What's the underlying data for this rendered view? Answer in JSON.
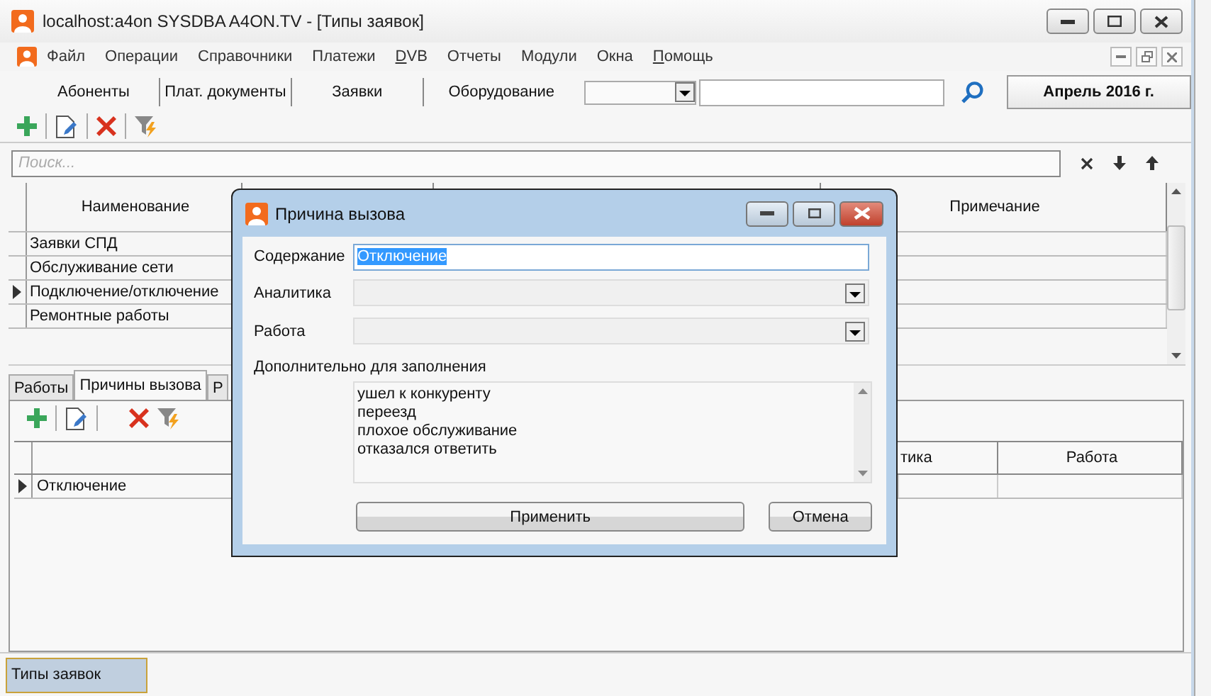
{
  "window": {
    "title": "localhost:a4on SYSDBA A4ON.TV - [Типы заявок]"
  },
  "menu": [
    {
      "label": "Файл",
      "underline_first": false
    },
    {
      "label": "Операции",
      "underline_first": false
    },
    {
      "label": "Справочники",
      "underline_first": false
    },
    {
      "label": "Платежи",
      "underline_first": false
    },
    {
      "label": "DVB",
      "underline_first": true
    },
    {
      "label": "Отчеты",
      "underline_first": false
    },
    {
      "label": "Модули",
      "underline_first": false
    },
    {
      "label": "Окна",
      "underline_first": false
    },
    {
      "label": "Помощь",
      "underline_first": true
    }
  ],
  "nav_tabs": [
    "Абоненты",
    "Плат. документы",
    "Заявки",
    "Оборудование"
  ],
  "period_button": "Апрель 2016 г.",
  "search": {
    "placeholder": "Поиск..."
  },
  "grid": {
    "columns": [
      "Наименование",
      "Примечание"
    ],
    "rows": [
      {
        "name": "Заявки СПД",
        "current": false
      },
      {
        "name": "Обслуживание сети",
        "current": false
      },
      {
        "name": "Подключение/отключение",
        "current": true
      },
      {
        "name": "Ремонтные работы",
        "current": false
      }
    ]
  },
  "detail_tabs": [
    {
      "label": "Работы",
      "selected": false
    },
    {
      "label": "Причины вызова",
      "selected": true
    },
    {
      "label": "Р",
      "selected": false
    }
  ],
  "detail_grid": {
    "columns": [
      "тика",
      "Работа"
    ],
    "rows": [
      {
        "name": "Отключение",
        "current": true
      }
    ]
  },
  "status_tabs": [
    {
      "label": "Типы заявок",
      "selected": true
    }
  ],
  "dialog": {
    "title": "Причина вызова",
    "fields": [
      {
        "kind": "text",
        "label": "Содержание",
        "value": "Отключение"
      },
      {
        "kind": "combo",
        "label": "Аналитика"
      },
      {
        "kind": "combo",
        "label": "Работа"
      }
    ],
    "extra_label": "Дополнительно для заполнения",
    "extra_lines": [
      "ушел к конкуренту",
      "переезд",
      "плохое обслуживание",
      "отказался ответить"
    ],
    "buttons": [
      "Применить",
      "Отмена"
    ]
  }
}
